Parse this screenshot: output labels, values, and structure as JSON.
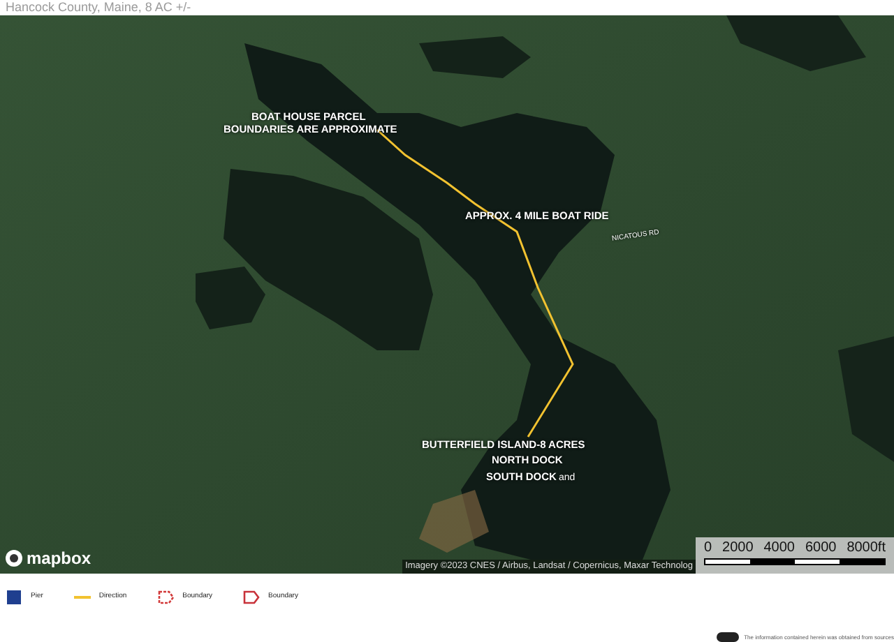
{
  "header": {
    "subtitle": "Hancock County, Maine, 8 AC +/-"
  },
  "map": {
    "labels": [
      {
        "text": "BOAT HOUSE PARCEL",
        "kind": "callout"
      },
      {
        "text": "BOUNDARIES ARE APPROXIMATE",
        "kind": "callout"
      },
      {
        "text": "APPROX. 4 MILE BOAT RIDE",
        "kind": "callout"
      },
      {
        "text": "NICATOUS RD",
        "kind": "road"
      },
      {
        "text": "BUTTERFIELD ISLAND-8 ACRES",
        "kind": "callout"
      },
      {
        "text": "NORTH DOCK",
        "kind": "callout"
      },
      {
        "text": "SOUTH DOCK",
        "kind": "callout"
      },
      {
        "text": "and",
        "kind": "place"
      }
    ],
    "logo": "mapbox",
    "attribution": "Imagery ©2023 CNES / Airbus, Landsat / Copernicus, Maxar Technolog",
    "scale_labels": [
      "0",
      "2000",
      "4000",
      "6000",
      "8000ft"
    ]
  },
  "legend": [
    {
      "label": "Pier",
      "kind": "pier",
      "color": "#1f3f8f"
    },
    {
      "label": "Direction",
      "kind": "line",
      "color": "#f2c230"
    },
    {
      "label": "Boundary",
      "kind": "dashed-area",
      "color": "#d23a3a"
    },
    {
      "label": "Boundary",
      "kind": "area",
      "color": "#c8323a"
    }
  ],
  "disclaimer": "The information contained herein was obtained from sources"
}
